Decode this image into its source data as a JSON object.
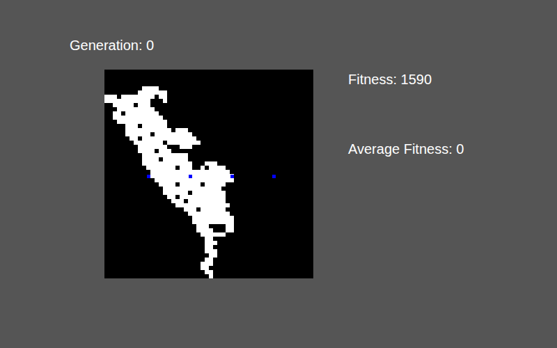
{
  "generation": {
    "label": "Generation: 0"
  },
  "stats": {
    "fitness": "Fitness: 1590",
    "average_fitness": "Average Fitness: 0"
  },
  "grid": {
    "size": 50,
    "cells": [
      [
        4,
        9,
        12
      ],
      [
        5,
        8,
        14
      ],
      [
        6,
        0,
        2
      ],
      [
        6,
        4,
        11
      ],
      [
        6,
        13,
        14
      ],
      [
        7,
        0,
        10
      ],
      [
        7,
        14,
        14
      ],
      [
        8,
        2,
        6
      ],
      [
        8,
        8,
        10
      ],
      [
        9,
        3,
        11
      ],
      [
        10,
        2,
        3
      ],
      [
        10,
        5,
        12
      ],
      [
        11,
        2,
        13
      ],
      [
        12,
        3,
        14
      ],
      [
        13,
        5,
        7
      ],
      [
        13,
        9,
        14
      ],
      [
        14,
        5,
        15
      ],
      [
        14,
        17,
        19
      ],
      [
        15,
        5,
        10
      ],
      [
        15,
        12,
        20
      ],
      [
        16,
        6,
        7
      ],
      [
        16,
        9,
        21
      ],
      [
        17,
        7,
        13
      ],
      [
        17,
        15,
        22
      ],
      [
        18,
        8,
        14
      ],
      [
        18,
        18,
        20
      ],
      [
        19,
        8,
        11
      ],
      [
        19,
        13,
        15
      ],
      [
        20,
        9,
        19
      ],
      [
        21,
        9,
        12
      ],
      [
        21,
        14,
        19
      ],
      [
        22,
        9,
        20
      ],
      [
        22,
        24,
        26
      ],
      [
        23,
        10,
        16
      ],
      [
        23,
        18,
        20
      ],
      [
        23,
        23,
        23
      ],
      [
        23,
        25,
        28
      ],
      [
        24,
        11,
        29
      ],
      [
        25,
        11,
        30
      ],
      [
        26,
        12,
        30
      ],
      [
        27,
        13,
        16
      ],
      [
        27,
        18,
        22
      ],
      [
        27,
        24,
        28
      ],
      [
        28,
        14,
        27
      ],
      [
        29,
        14,
        19
      ],
      [
        29,
        21,
        28
      ],
      [
        30,
        15,
        16
      ],
      [
        30,
        18,
        28
      ],
      [
        31,
        16,
        18
      ],
      [
        31,
        20,
        28
      ],
      [
        32,
        17,
        29
      ],
      [
        33,
        19,
        21
      ],
      [
        33,
        23,
        28
      ],
      [
        34,
        20,
        29
      ],
      [
        35,
        21,
        30
      ],
      [
        36,
        21,
        30
      ],
      [
        37,
        22,
        24
      ],
      [
        37,
        29,
        30
      ],
      [
        38,
        22,
        25
      ],
      [
        38,
        29,
        30
      ],
      [
        39,
        23,
        28
      ],
      [
        40,
        24,
        25
      ],
      [
        41,
        24,
        26
      ],
      [
        42,
        24,
        25
      ],
      [
        43,
        24,
        26
      ],
      [
        44,
        25,
        26
      ],
      [
        45,
        24,
        25
      ],
      [
        46,
        23,
        25
      ],
      [
        47,
        23,
        24
      ],
      [
        48,
        24,
        25
      ],
      [
        49,
        25,
        25
      ]
    ],
    "markers": [
      {
        "col": 10,
        "row": 25,
        "color": "#0000ff"
      },
      {
        "col": 20,
        "row": 25,
        "color": "#0000ff"
      },
      {
        "col": 30,
        "row": 25,
        "color": "#0000ff"
      },
      {
        "col": 40,
        "row": 25,
        "color": "#0000ff"
      }
    ]
  }
}
